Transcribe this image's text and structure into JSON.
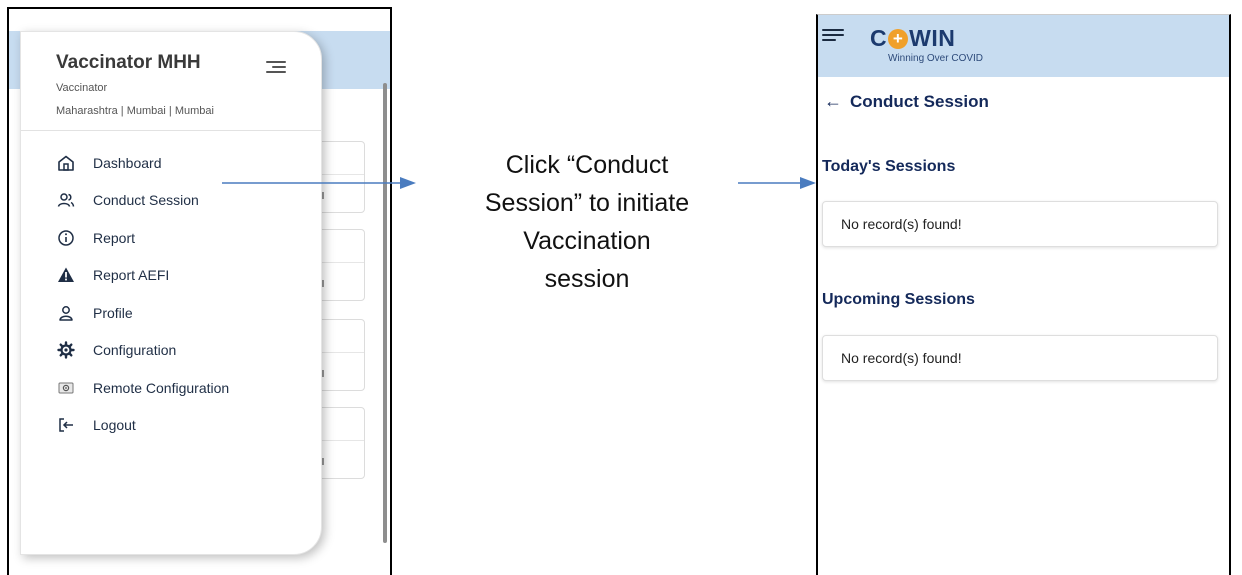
{
  "drawer": {
    "name": "Vaccinator MHH",
    "role": "Vaccinator",
    "location": "Maharashtra | Mumbai | Mumbai",
    "items": [
      {
        "label": "Dashboard",
        "icon": "home-icon"
      },
      {
        "label": "Conduct Session",
        "icon": "users-icon"
      },
      {
        "label": "Report",
        "icon": "info-icon"
      },
      {
        "label": "Report AEFI",
        "icon": "warning-icon"
      },
      {
        "label": "Profile",
        "icon": "user-icon"
      },
      {
        "label": "Configuration",
        "icon": "settings-icon"
      },
      {
        "label": "Remote Configuration",
        "icon": "remote-config-icon"
      },
      {
        "label": "Logout",
        "icon": "logout-icon"
      }
    ]
  },
  "instruction": {
    "lines": [
      "Click “Conduct",
      "Session” to initiate",
      "Vaccination",
      "session"
    ]
  },
  "app": {
    "logo": {
      "prefix": "C",
      "suffix": "WIN",
      "tagline": "Winning Over COVID"
    },
    "page_title": "Conduct Session",
    "sections": [
      {
        "title": "Today's Sessions",
        "empty_text": "No record(s) found!"
      },
      {
        "title": "Upcoming Sessions",
        "empty_text": "No record(s) found!"
      }
    ]
  },
  "colors": {
    "header_bg": "#c7dcf0",
    "title_text": "#14295a",
    "arrow": "#4a7cbf",
    "logo_plus": "#f0a02a"
  }
}
